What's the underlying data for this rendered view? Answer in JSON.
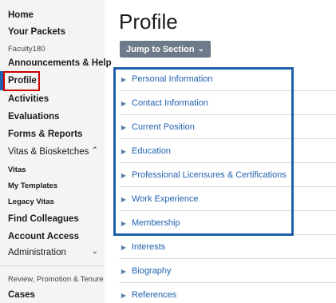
{
  "sidebar": {
    "home": "Home",
    "your_packets": "Your Packets",
    "group_label": "Faculty180",
    "announcements": "Announcements & Help",
    "profile": "Profile",
    "activities": "Activities",
    "evaluations": "Evaluations",
    "forms_reports": "Forms & Reports",
    "vitas_biosketches": "Vitas & Biosketches",
    "vitas": "Vitas",
    "my_templates": "My Templates",
    "legacy_vitas": "Legacy Vitas",
    "find_colleagues": "Find Colleagues",
    "account_access": "Account Access",
    "administration": "Administration",
    "rpt_label": "Review, Promotion & Tenure",
    "cases": "Cases"
  },
  "main": {
    "title": "Profile",
    "jump_button": "Jump to Section",
    "sections": [
      "Personal Information",
      "Contact Information",
      "Current Position",
      "Education",
      "Professional Licensures & Certifications",
      "Work Experience",
      "Membership",
      "Interests",
      "Biography",
      "References"
    ]
  },
  "colors": {
    "accent": "#1f62b0",
    "highlight_box": "#1f5fa8",
    "active_outline": "#cc0000",
    "button_bg": "#6c7a89"
  }
}
